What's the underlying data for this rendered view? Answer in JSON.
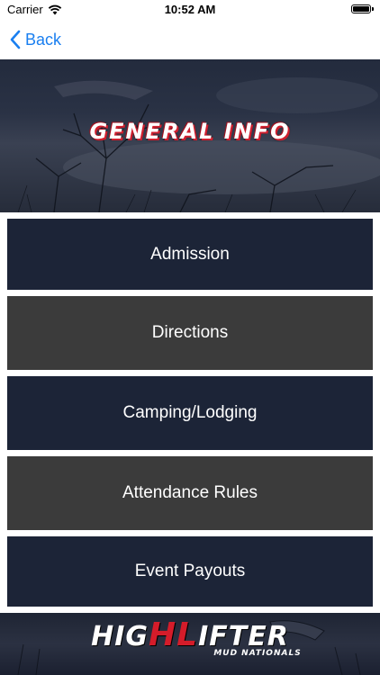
{
  "status_bar": {
    "carrier": "Carrier",
    "time": "10:52 AM",
    "icons": [
      "wifi-icon",
      "battery-icon"
    ]
  },
  "nav": {
    "back_label": "Back",
    "back_icon": "chevron-left-icon",
    "accent_color": "#1a7ff0"
  },
  "header": {
    "title": "GENERAL INFO"
  },
  "menu": {
    "items": [
      {
        "label": "Admission",
        "color": "#1c2437"
      },
      {
        "label": "Directions",
        "color": "#3b3b3b"
      },
      {
        "label": "Camping/Lodging",
        "color": "#1c2437"
      },
      {
        "label": "Attendance Rules",
        "color": "#3b3b3b"
      },
      {
        "label": "Event Payouts",
        "color": "#1c2437"
      }
    ]
  },
  "footer": {
    "logo_prefix": "HIG",
    "logo_highlight": "HL",
    "logo_suffix": "IFTER",
    "logo_sub": "MUD NATIONALS",
    "logo_accent": "#d41c2a"
  }
}
